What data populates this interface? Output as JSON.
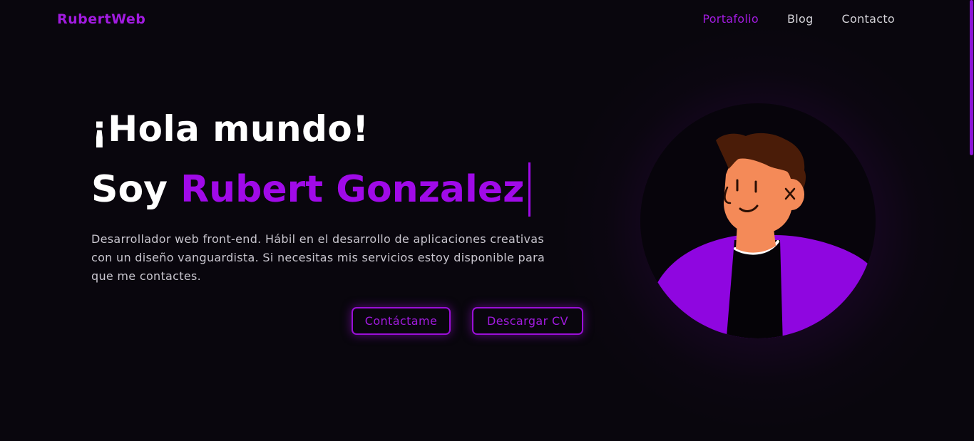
{
  "header": {
    "logo": "RubertWeb",
    "nav": [
      {
        "label": "Portafolio",
        "active": true
      },
      {
        "label": "Blog",
        "active": false
      },
      {
        "label": "Contacto",
        "active": false
      }
    ]
  },
  "hero": {
    "greeting": "¡Hola mundo!",
    "intro_prefix": "Soy",
    "name": "Rubert Gonzalez",
    "description": "Desarrollador web front-end. Hábil en el desarrollo de aplicaciones creativas con un diseño vanguardista. Si necesitas mis servicios estoy disponible para que me contactes.",
    "buttons": {
      "contact": "Contáctame",
      "cv": "Descargar CV"
    }
  },
  "colors": {
    "background": "#09060d",
    "accent": "#a00ae8",
    "text": "#ffffff",
    "muted_text": "#c9c6cf"
  },
  "avatar": {
    "icon": "person-illustration-icon"
  }
}
